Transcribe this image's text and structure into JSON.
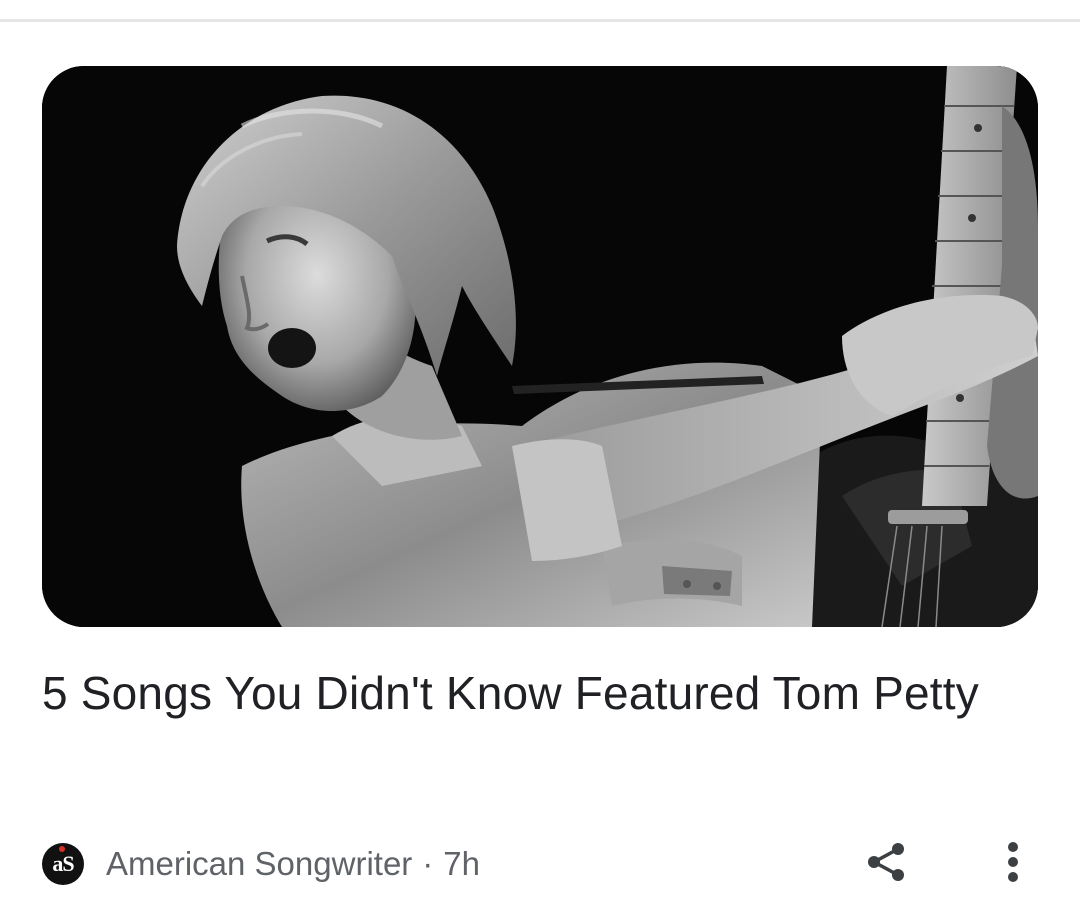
{
  "article": {
    "image_alt": "Black and white photo of Tom Petty performing with a guitar",
    "headline": "5 Songs You Didn't Know Featured Tom Petty",
    "source": {
      "name": "American Songwriter",
      "logo_text": "aS",
      "separator": "·",
      "time": "7h"
    }
  },
  "actions": {
    "share_icon": "share-icon",
    "more_icon": "more-vert-icon"
  },
  "colors": {
    "headline": "#202124",
    "meta_text": "#5f6368",
    "divider": "#e6e6e6"
  }
}
